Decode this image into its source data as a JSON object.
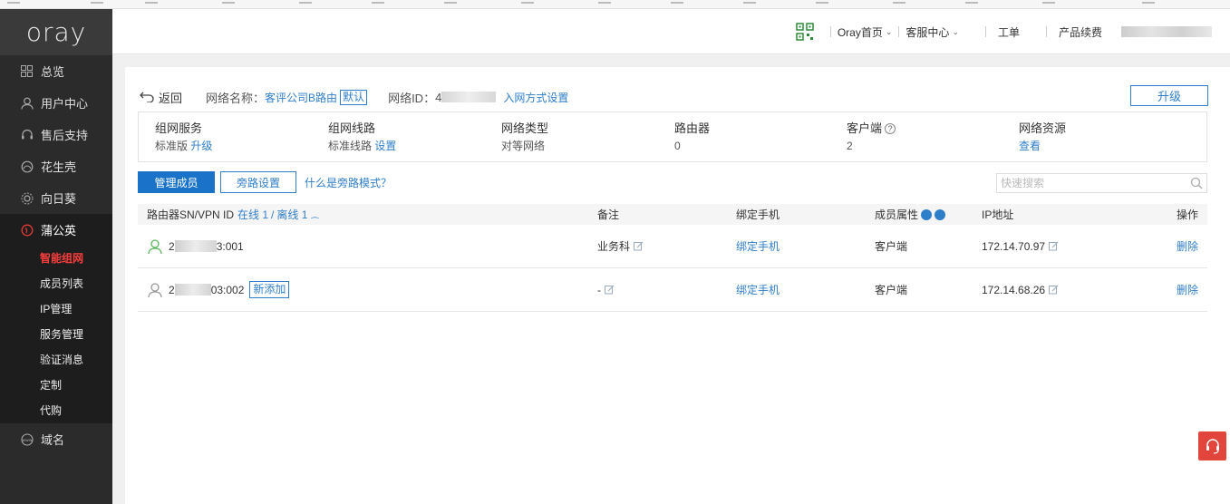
{
  "sidebar": {
    "logo": "oray",
    "items": [
      {
        "label": "总览",
        "icon": "grid-icon"
      },
      {
        "label": "用户中心",
        "icon": "user-icon"
      },
      {
        "label": "售后支持",
        "icon": "headset-icon"
      },
      {
        "label": "花生壳",
        "icon": "peanut-icon"
      },
      {
        "label": "向日葵",
        "icon": "sunflower-icon"
      },
      {
        "label": "蒲公英",
        "icon": "dandelion-icon"
      }
    ],
    "sub_items": [
      "智能组网",
      "成员列表",
      "IP管理",
      "服务管理",
      "验证消息",
      "定制",
      "代购"
    ],
    "bottom_item": {
      "label": "域名",
      "icon": "www-icon"
    }
  },
  "header": {
    "home": "Oray首页",
    "service": "客服中心",
    "ticket": "工单",
    "renew": "产品续费"
  },
  "network": {
    "back": "返回",
    "name_label": "网络名称：",
    "name_value": "客评公司B路由",
    "default_tag": "默认",
    "id_label": "网络ID：",
    "id_prefix": "4",
    "join_link": "入网方式设置",
    "upgrade": "升级"
  },
  "info": [
    {
      "title": "组网服务",
      "value": "标准版",
      "link": "升级"
    },
    {
      "title": "组网线路",
      "value": "标准线路",
      "link": "设置"
    },
    {
      "title": "网络类型",
      "value": "对等网络",
      "link": ""
    },
    {
      "title": "路由器",
      "value": "0",
      "link": ""
    },
    {
      "title": "客户端",
      "value": "2",
      "link": ""
    },
    {
      "title": "网络资源",
      "value": "",
      "link": "查看"
    }
  ],
  "actions": {
    "manage": "管理成员",
    "bypass": "旁路设置",
    "help": "什么是旁路模式？",
    "search_placeholder": "快速搜索"
  },
  "table": {
    "col_sn": "路由器SN/VPN ID",
    "online": "在线 1",
    "slash": "/",
    "offline": "离线 1",
    "col_note": "备注",
    "col_phone": "绑定手机",
    "col_attr": "成员属性",
    "col_ip": "IP地址",
    "col_op": "操作",
    "rows": [
      {
        "id_prefix": "2",
        "id_suffix": "3:001",
        "note": "业务科",
        "phone": "绑定手机",
        "attr": "客户端",
        "ip": "172.14.70.97",
        "op": "删除",
        "online": true,
        "tag": ""
      },
      {
        "id_prefix": "2",
        "id_suffix": "03:002",
        "note": "-",
        "phone": "绑定手机",
        "attr": "客户端",
        "ip": "172.14.68.26",
        "op": "删除",
        "online": false,
        "tag": "新添加"
      }
    ]
  },
  "colors": {
    "accent": "#2f7ec9",
    "primary_btn": "#1a73c8",
    "sidebar_bg": "#2b2b2b",
    "active_red": "#ff3d3d"
  }
}
